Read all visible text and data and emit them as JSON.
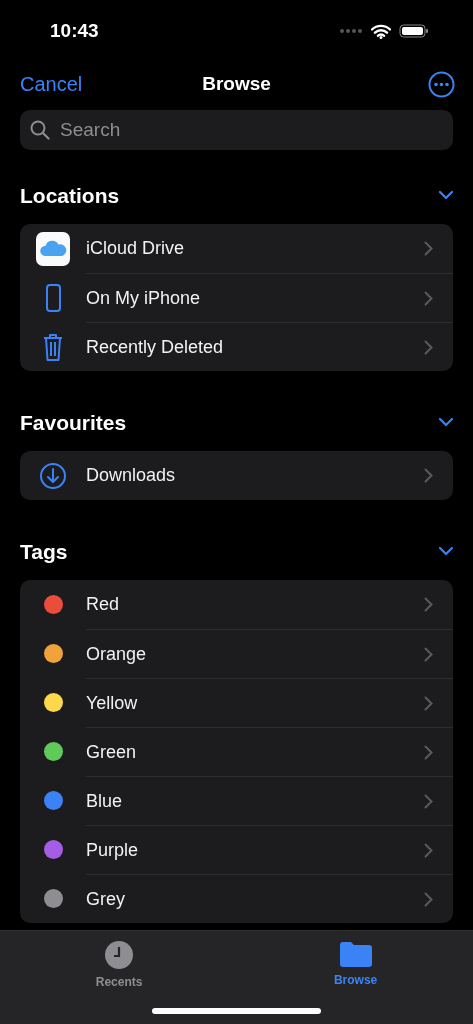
{
  "status_bar": {
    "time": "10:43"
  },
  "nav": {
    "cancel": "Cancel",
    "title": "Browse"
  },
  "search": {
    "placeholder": "Search"
  },
  "sections": [
    {
      "title": "Locations",
      "expanded": true,
      "items": [
        {
          "label": "iCloud Drive",
          "kind": "icloud"
        },
        {
          "label": "On My iPhone",
          "kind": "phone"
        },
        {
          "label": "Recently Deleted",
          "kind": "trash"
        }
      ]
    },
    {
      "title": "Favourites",
      "expanded": true,
      "items": [
        {
          "label": "Downloads",
          "kind": "download"
        }
      ]
    },
    {
      "title": "Tags",
      "expanded": true,
      "items": [
        {
          "label": "Red",
          "kind": "tag",
          "color": "#eb4d3d"
        },
        {
          "label": "Orange",
          "kind": "tag",
          "color": "#f0a33a"
        },
        {
          "label": "Yellow",
          "kind": "tag",
          "color": "#fbd94a"
        },
        {
          "label": "Green",
          "kind": "tag",
          "color": "#5fca5a"
        },
        {
          "label": "Blue",
          "kind": "tag",
          "color": "#3b82f6"
        },
        {
          "label": "Purple",
          "kind": "tag",
          "color": "#a65de5"
        },
        {
          "label": "Grey",
          "kind": "tag",
          "color": "#8e8e92"
        }
      ]
    }
  ],
  "tab_bar": [
    {
      "label": "Recents",
      "kind": "clock",
      "selected": false
    },
    {
      "label": "Browse",
      "kind": "folder",
      "selected": true
    }
  ]
}
